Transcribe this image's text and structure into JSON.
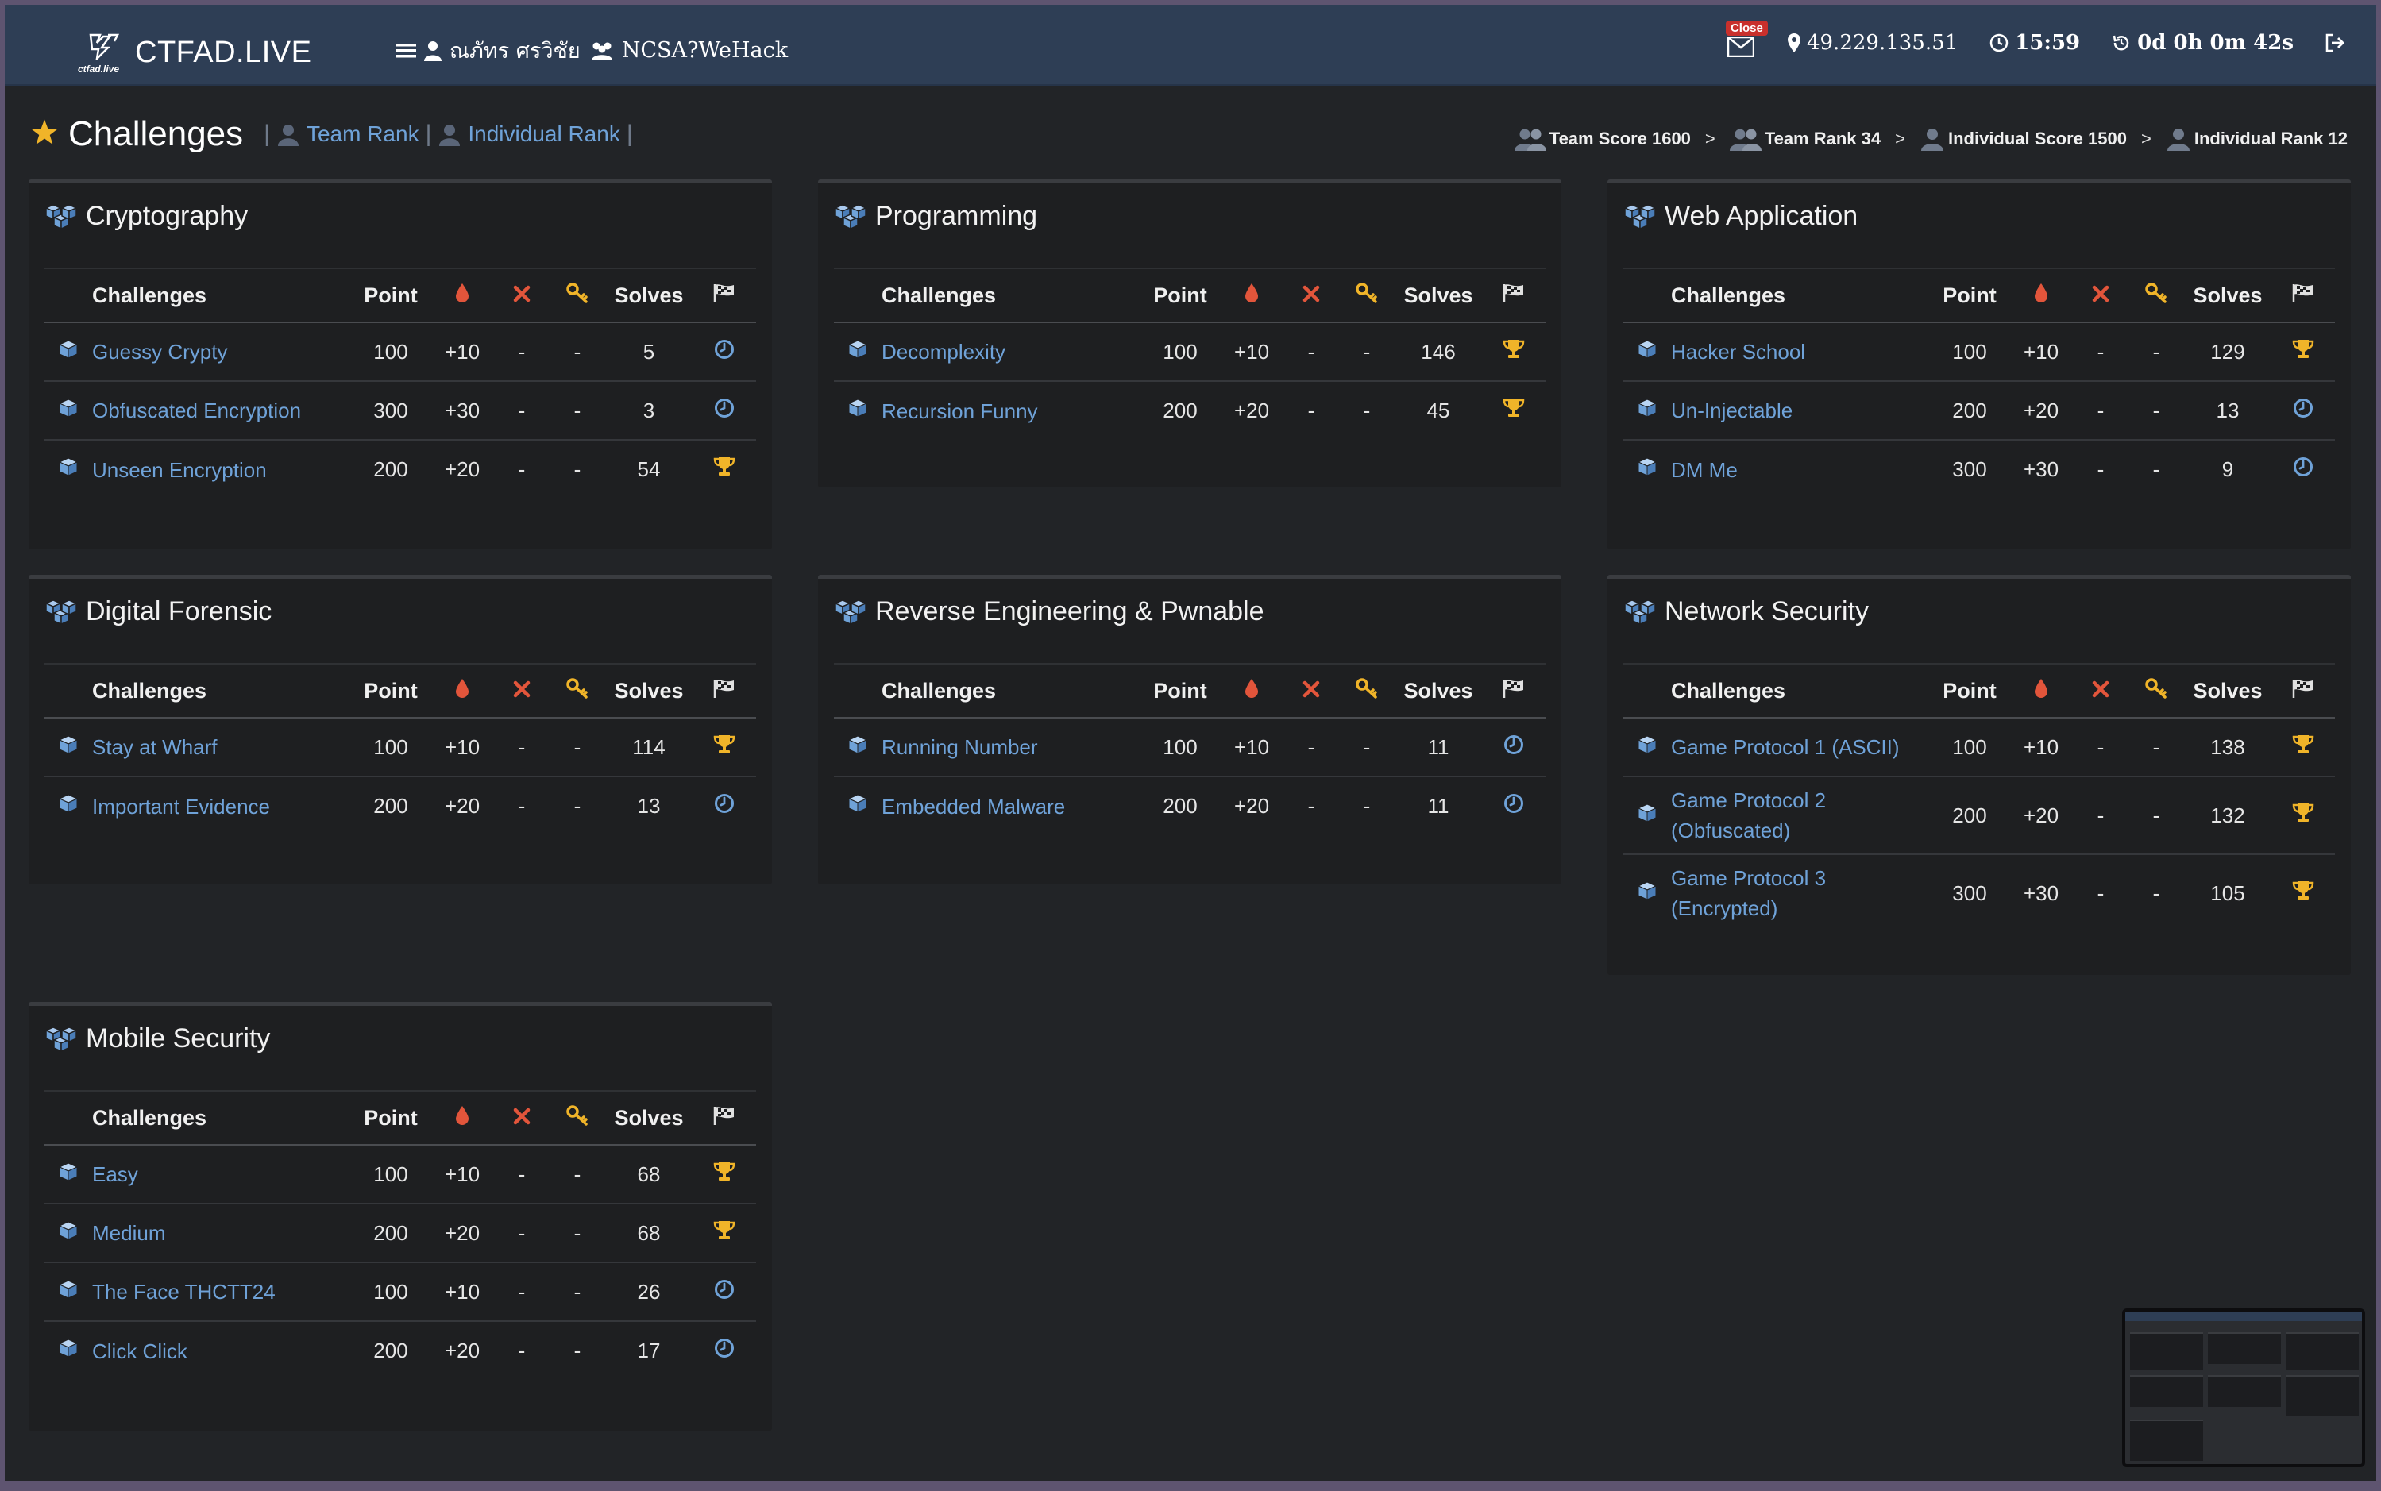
{
  "navbar": {
    "brand": "CTFAD.LIVE",
    "brand_sub": "ctfad.live",
    "user_name": "ณภัทร ศรวิชัย",
    "team_name": "NCSA?WeHack",
    "mail_badge": "Close",
    "ip": "49.229.135.51",
    "clock": "15:59",
    "elapsed": "0d 0h 0m 42s"
  },
  "header": {
    "title": "Challenges",
    "team_rank_link": "Team Rank",
    "individual_rank_link": "Individual Rank",
    "team_score": "Team Score 1600",
    "team_rank": "Team Rank 34",
    "individual_score": "Individual Score 1500",
    "individual_rank": "Individual Rank 12",
    "separator": ">"
  },
  "table_headers": {
    "challenges": "Challenges",
    "point": "Point",
    "solves": "Solves"
  },
  "colors": {
    "accent": "#6fa2d8",
    "blood": "#e2553b",
    "cross": "#e2553b",
    "key": "#f0b429",
    "trophy": "#f0b429",
    "clock": "#6fa2d8"
  },
  "categories": [
    {
      "name": "Cryptography",
      "challenges": [
        {
          "name": "Guessy Crypty",
          "point": "100",
          "bonus": "+10",
          "fail": "-",
          "hint": "-",
          "solves": "5",
          "status": "clock-icon"
        },
        {
          "name": "Obfuscated Encryption",
          "point": "300",
          "bonus": "+30",
          "fail": "-",
          "hint": "-",
          "solves": "3",
          "status": "clock-icon"
        },
        {
          "name": "Unseen Encryption",
          "point": "200",
          "bonus": "+20",
          "fail": "-",
          "hint": "-",
          "solves": "54",
          "status": "trophy-icon"
        }
      ]
    },
    {
      "name": "Programming",
      "challenges": [
        {
          "name": "Decomplexity",
          "point": "100",
          "bonus": "+10",
          "fail": "-",
          "hint": "-",
          "solves": "146",
          "status": "trophy-icon"
        },
        {
          "name": "Recursion Funny",
          "point": "200",
          "bonus": "+20",
          "fail": "-",
          "hint": "-",
          "solves": "45",
          "status": "trophy-icon"
        }
      ]
    },
    {
      "name": "Web Application",
      "challenges": [
        {
          "name": "Hacker School",
          "point": "100",
          "bonus": "+10",
          "fail": "-",
          "hint": "-",
          "solves": "129",
          "status": "trophy-icon"
        },
        {
          "name": "Un-Injectable",
          "point": "200",
          "bonus": "+20",
          "fail": "-",
          "hint": "-",
          "solves": "13",
          "status": "clock-icon"
        },
        {
          "name": "DM Me",
          "point": "300",
          "bonus": "+30",
          "fail": "-",
          "hint": "-",
          "solves": "9",
          "status": "clock-icon"
        }
      ]
    },
    {
      "name": "Digital Forensic",
      "challenges": [
        {
          "name": "Stay at Wharf",
          "point": "100",
          "bonus": "+10",
          "fail": "-",
          "hint": "-",
          "solves": "114",
          "status": "trophy-icon"
        },
        {
          "name": "Important Evidence",
          "point": "200",
          "bonus": "+20",
          "fail": "-",
          "hint": "-",
          "solves": "13",
          "status": "clock-icon"
        }
      ]
    },
    {
      "name": "Reverse Engineering & Pwnable",
      "challenges": [
        {
          "name": "Running Number",
          "point": "100",
          "bonus": "+10",
          "fail": "-",
          "hint": "-",
          "solves": "11",
          "status": "clock-icon"
        },
        {
          "name": "Embedded Malware",
          "point": "200",
          "bonus": "+20",
          "fail": "-",
          "hint": "-",
          "solves": "11",
          "status": "clock-icon"
        }
      ]
    },
    {
      "name": "Network Security",
      "challenges": [
        {
          "name": "Game Protocol 1 (ASCII)",
          "point": "100",
          "bonus": "+10",
          "fail": "-",
          "hint": "-",
          "solves": "138",
          "status": "trophy-icon"
        },
        {
          "name": "Game Protocol 2 (Obfuscated)",
          "point": "200",
          "bonus": "+20",
          "fail": "-",
          "hint": "-",
          "solves": "132",
          "status": "trophy-icon"
        },
        {
          "name": "Game Protocol 3 (Encrypted)",
          "point": "300",
          "bonus": "+30",
          "fail": "-",
          "hint": "-",
          "solves": "105",
          "status": "trophy-icon"
        }
      ]
    },
    {
      "name": "Mobile Security",
      "challenges": [
        {
          "name": "Easy",
          "point": "100",
          "bonus": "+10",
          "fail": "-",
          "hint": "-",
          "solves": "68",
          "status": "trophy-icon"
        },
        {
          "name": "Medium",
          "point": "200",
          "bonus": "+20",
          "fail": "-",
          "hint": "-",
          "solves": "68",
          "status": "trophy-icon"
        },
        {
          "name": "The Face THCTT24",
          "point": "100",
          "bonus": "+10",
          "fail": "-",
          "hint": "-",
          "solves": "26",
          "status": "clock-icon"
        },
        {
          "name": "Click Click",
          "point": "200",
          "bonus": "+20",
          "fail": "-",
          "hint": "-",
          "solves": "17",
          "status": "clock-icon"
        }
      ]
    }
  ]
}
